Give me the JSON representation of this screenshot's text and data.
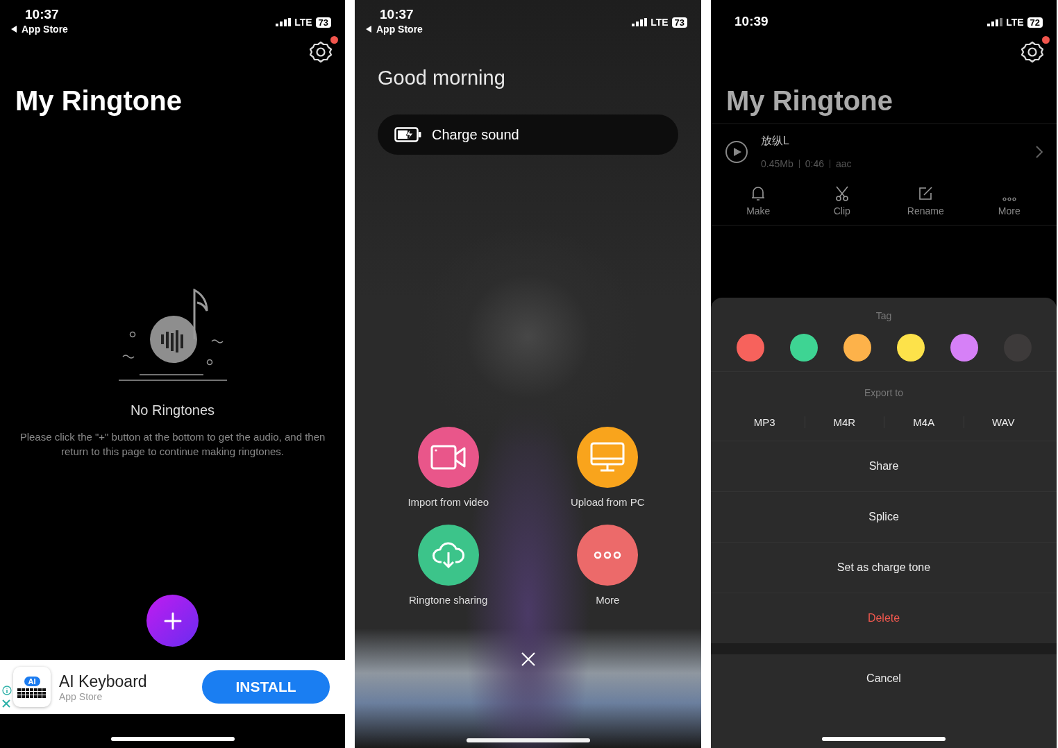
{
  "phones": [
    {
      "kind": "empty",
      "status": {
        "time": "10:37",
        "back": "App Store",
        "network": "LTE",
        "battery": "73"
      },
      "settings_badge": true,
      "title": "My Ringtone",
      "empty_title": "No Ringtones",
      "empty_text": "Please click the \"+\" button at the bottom to get the audio, and then return to this page to continue making ringtones.",
      "ad": {
        "icon_text": "AI",
        "app": "AI Keyboard",
        "store": "App Store",
        "button": "INSTALL"
      }
    },
    {
      "kind": "menu",
      "status": {
        "time": "10:37",
        "back": "App Store",
        "network": "LTE",
        "battery": "73"
      },
      "greeting": "Good morning",
      "pill": "Charge sound",
      "actions": [
        {
          "label": "Import from video",
          "color": "#e9568a"
        },
        {
          "label": "Upload from PC",
          "color": "#f9a41c"
        },
        {
          "label": "Ringtone sharing",
          "color": "#3cc48a"
        },
        {
          "label": "More",
          "color": "#ec6a6a"
        }
      ]
    },
    {
      "kind": "sheet",
      "status": {
        "time": "10:39",
        "network": "LTE",
        "battery": "72"
      },
      "settings_badge": true,
      "title": "My Ringtone",
      "song": {
        "name": "放纵L",
        "size": "0.45Mb",
        "duration": "0:46",
        "format": "aac"
      },
      "tools": [
        "Make",
        "Clip",
        "Rename",
        "More"
      ],
      "sheet": {
        "tag_title": "Tag",
        "tags": [
          {
            "color": "#f7625c"
          },
          {
            "color": "#3ed493"
          },
          {
            "color": "#fdb24a"
          },
          {
            "color": "#fde24a"
          },
          {
            "color": "#d680f7"
          },
          {
            "color": "#3d3a3a"
          }
        ],
        "export_title": "Export to",
        "formats": [
          "MP3",
          "M4R",
          "M4A",
          "WAV"
        ],
        "actions": [
          {
            "label": "Share",
            "kind": "normal"
          },
          {
            "label": "Splice",
            "kind": "normal"
          },
          {
            "label": "Set as charge tone",
            "kind": "normal"
          },
          {
            "label": "Delete",
            "kind": "destructive"
          }
        ],
        "cancel": "Cancel"
      }
    }
  ]
}
